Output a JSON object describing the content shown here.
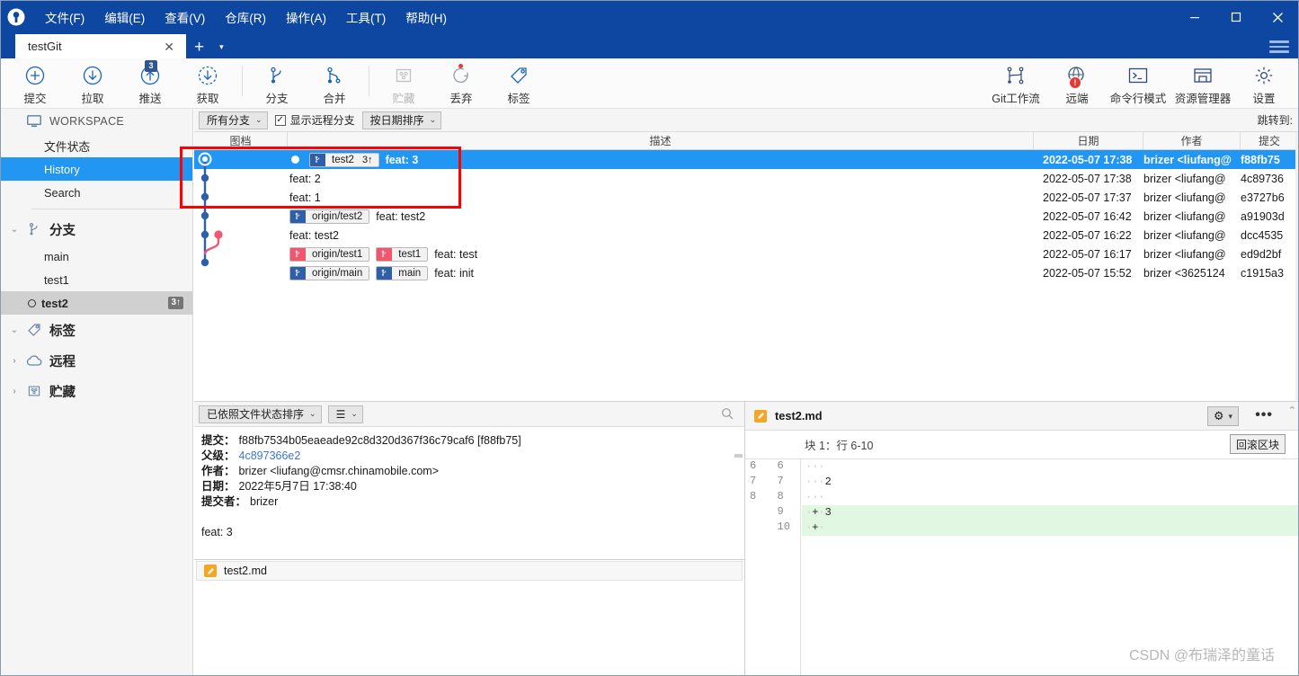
{
  "window": {
    "title": "testGit",
    "minimize": "–",
    "maximize": "□",
    "close": "✕"
  },
  "menubar": {
    "items": [
      {
        "label": "文件(F)",
        "name": "menu-file"
      },
      {
        "label": "编辑(E)",
        "name": "menu-edit"
      },
      {
        "label": "查看(V)",
        "name": "menu-view"
      },
      {
        "label": "仓库(R)",
        "name": "menu-repository"
      },
      {
        "label": "操作(A)",
        "name": "menu-actions"
      },
      {
        "label": "工具(T)",
        "name": "menu-tools"
      },
      {
        "label": "帮助(H)",
        "name": "menu-help"
      }
    ]
  },
  "tabs": {
    "active": "testGit",
    "close_label": "✕",
    "add_label": "+",
    "add_caret": "▾"
  },
  "toolbar": {
    "left": [
      {
        "label": "提交",
        "icon": "commit-icon",
        "badge": "",
        "disabled": false
      },
      {
        "label": "拉取",
        "icon": "pull-icon",
        "badge": "",
        "disabled": false
      },
      {
        "label": "推送",
        "icon": "push-icon",
        "badge": "3",
        "disabled": false
      },
      {
        "label": "获取",
        "icon": "fetch-icon",
        "badge": "",
        "disabled": false
      },
      {
        "label": "分支",
        "icon": "branch-icon",
        "badge": "",
        "disabled": false
      },
      {
        "label": "合并",
        "icon": "merge-icon",
        "badge": "",
        "disabled": false
      },
      {
        "label": "贮藏",
        "icon": "stash-icon",
        "badge": "",
        "disabled": true
      },
      {
        "label": "丢弃",
        "icon": "discard-icon",
        "badge": "",
        "disabled": false
      },
      {
        "label": "标签",
        "icon": "tag-icon",
        "badge": "",
        "disabled": false
      }
    ],
    "right": [
      {
        "label": "Git工作流",
        "icon": "gitflow-icon",
        "badge": ""
      },
      {
        "label": "远端",
        "icon": "remote-icon",
        "badge": "!"
      },
      {
        "label": "命令行模式",
        "icon": "terminal-icon",
        "badge": ""
      },
      {
        "label": "资源管理器",
        "icon": "explorer-icon",
        "badge": ""
      },
      {
        "label": "设置",
        "icon": "gear-icon",
        "badge": ""
      }
    ]
  },
  "sidebar": {
    "workspace_label": "WORKSPACE",
    "workspace_items": [
      {
        "label": "文件状态",
        "selected": false
      },
      {
        "label": "History",
        "selected": true
      },
      {
        "label": "Search",
        "selected": false
      }
    ],
    "groups": [
      {
        "label": "分支",
        "icon": "branch-icon",
        "expanded": true,
        "items": [
          {
            "label": "main",
            "current": false,
            "badge": ""
          },
          {
            "label": "test1",
            "current": false,
            "badge": ""
          },
          {
            "label": "test2",
            "current": true,
            "badge": "3↑"
          }
        ]
      },
      {
        "label": "标签",
        "icon": "tag-icon",
        "expanded": true,
        "items": []
      },
      {
        "label": "远程",
        "icon": "cloud-icon",
        "expanded": false,
        "items": []
      },
      {
        "label": "贮藏",
        "icon": "stash-icon",
        "expanded": false,
        "items": []
      }
    ]
  },
  "filterbar": {
    "branch_filter": "所有分支",
    "show_remote_label": "显示远程分支",
    "show_remote_checked": true,
    "sort_mode": "按日期排序",
    "jump_to_label": "跳转到:"
  },
  "commit_table": {
    "columns": [
      "图档",
      "描述",
      "日期",
      "作者",
      "提交"
    ],
    "rows": [
      {
        "selected": true,
        "head": true,
        "refs": [
          {
            "text": "test2",
            "count": "3↑",
            "color": "blue"
          }
        ],
        "description": "feat: 3",
        "date": "2022-05-07 17:38",
        "author": "brizer <liufang@",
        "hash": "f88fb75"
      },
      {
        "selected": false,
        "head": false,
        "refs": [],
        "description": "feat: 2",
        "date": "2022-05-07 17:38",
        "author": "brizer <liufang@",
        "hash": "4c89736"
      },
      {
        "selected": false,
        "head": false,
        "refs": [],
        "description": "feat: 1",
        "date": "2022-05-07 17:37",
        "author": "brizer <liufang@",
        "hash": "e3727b6"
      },
      {
        "selected": false,
        "head": false,
        "refs": [
          {
            "text": "origin/test2",
            "count": "",
            "color": "blue"
          }
        ],
        "description": "feat: test2",
        "date": "2022-05-07 16:42",
        "author": "brizer <liufang@",
        "hash": "a91903d"
      },
      {
        "selected": false,
        "head": false,
        "refs": [],
        "description": "feat: test2",
        "date": "2022-05-07 16:22",
        "author": "brizer <liufang@",
        "hash": "dcc4535"
      },
      {
        "selected": false,
        "head": false,
        "refs": [
          {
            "text": "origin/test1",
            "count": "",
            "color": "pink"
          },
          {
            "text": "test1",
            "count": "",
            "color": "pink"
          }
        ],
        "description": "feat: test",
        "date": "2022-05-07 16:17",
        "author": "brizer <liufang@",
        "hash": "ed9d2bf"
      },
      {
        "selected": false,
        "head": false,
        "refs": [
          {
            "text": "origin/main",
            "count": "",
            "color": "blue"
          },
          {
            "text": "main",
            "count": "",
            "color": "blue"
          }
        ],
        "description": "feat: init",
        "date": "2022-05-07 15:52",
        "author": "brizer <3625124",
        "hash": "c1915a3"
      }
    ]
  },
  "detail_panel": {
    "sort_label": "已依照文件状态排序",
    "view_label": "☰",
    "fields": [
      {
        "key": "提交：",
        "value": "f88fb7534b05eaeade92c8d320d367f36c79caf6 [f88fb75]",
        "link": false
      },
      {
        "key": "父级：",
        "value": "4c897366e2",
        "link": true
      },
      {
        "key": "作者：",
        "value": "brizer <liufang@cmsr.chinamobile.com>",
        "link": false
      },
      {
        "key": "日期：",
        "value": "2022年5月7日 17:38:40",
        "link": false
      },
      {
        "key": "提交者：",
        "value": "brizer",
        "link": false
      }
    ],
    "message": "feat: 3",
    "files": [
      {
        "name": "test2.md",
        "icon": "markdown-icon"
      }
    ]
  },
  "diff_panel": {
    "filename": "test2.md",
    "file_icon": "markdown-icon",
    "gear_label": "⚙",
    "gear_caret": "▾",
    "more_label": "•••",
    "hunk_label": "块 1：行 6-10",
    "rollback_label": "回滚区块",
    "lines": [
      {
        "old": "6",
        "new": "6",
        "marker": "",
        "text": "",
        "added": false
      },
      {
        "old": "7",
        "new": "7",
        "marker": "",
        "text": "2",
        "added": false
      },
      {
        "old": "8",
        "new": "8",
        "marker": "",
        "text": "",
        "added": false
      },
      {
        "old": "",
        "new": "9",
        "marker": "+",
        "text": "3",
        "added": true
      },
      {
        "old": "",
        "new": "10",
        "marker": "+",
        "text": "",
        "added": true
      }
    ]
  },
  "watermark": "CSDN @布瑞泽的童话",
  "colors": {
    "title_blue": "#0d47a1",
    "select_blue": "#2196f3",
    "ref_blue": "#2f5fa8",
    "ref_pink": "#f1566f",
    "graph_blue": "#2f5fa8",
    "graph_pink": "#f1566f",
    "add_green": "#e2f7e1",
    "annotation_red": "#ff0000"
  }
}
